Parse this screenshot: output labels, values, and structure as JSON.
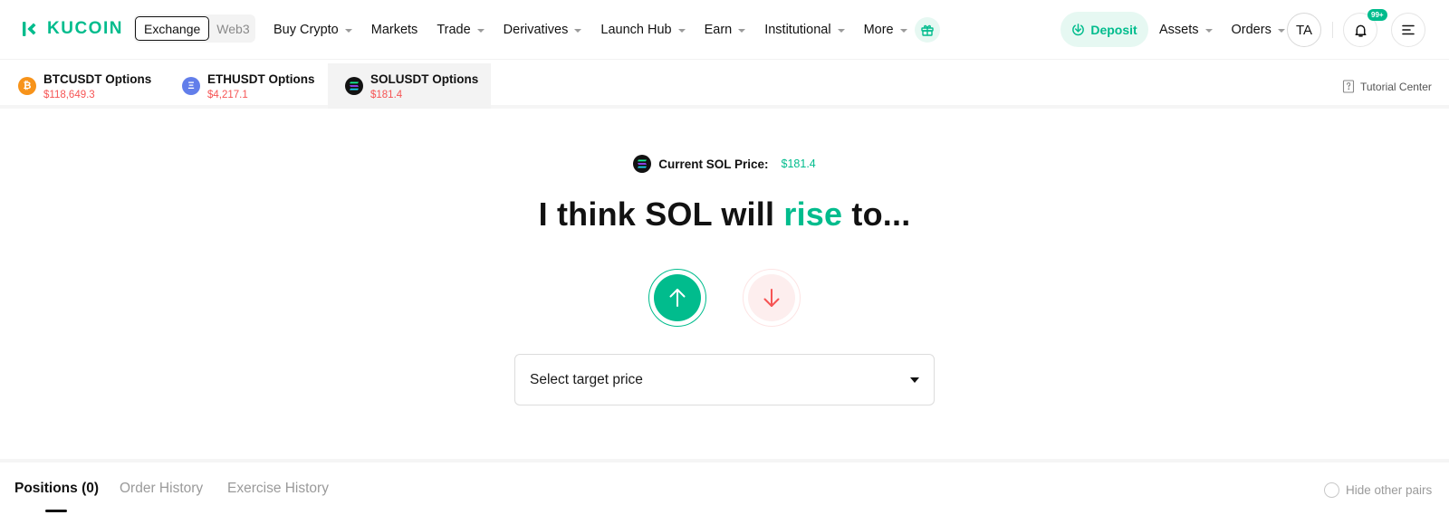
{
  "header": {
    "logo_text": "KUCOIN",
    "exchange_label": "Exchange",
    "web3_label": "Web3",
    "menu": [
      {
        "label": "Buy Crypto",
        "has_caret": true
      },
      {
        "label": "Markets",
        "has_caret": false
      },
      {
        "label": "Trade",
        "has_caret": true
      },
      {
        "label": "Derivatives",
        "has_caret": true
      },
      {
        "label": "Launch Hub",
        "has_caret": true
      },
      {
        "label": "Earn",
        "has_caret": true
      },
      {
        "label": "Institutional",
        "has_caret": true
      },
      {
        "label": "More",
        "has_caret": true
      }
    ],
    "deposit_label": "Deposit",
    "assets_label": "Assets",
    "orders_label": "Orders",
    "avatar_initials": "TA",
    "notification_badge": "99+",
    "icons": [
      "kucoin-logo-icon",
      "gift-icon",
      "download-icon",
      "bell-icon",
      "menu-icon"
    ],
    "accent_color": "#01bc8d"
  },
  "options_tabs": [
    {
      "name": "BTCUSDT Options",
      "price": "$118,649.3",
      "coin_color": "#f7931a",
      "coin_glyph": "₿",
      "active": false
    },
    {
      "name": "ETHUSDT Options",
      "price": "$4,217.1",
      "coin_color": "#627eea",
      "coin_glyph": "Ξ",
      "active": false
    },
    {
      "name": "SOLUSDT Options",
      "price": "$181.4",
      "coin_color": "#121212",
      "coin_glyph": "≡",
      "active": true
    }
  ],
  "tutorial_label": "Tutorial Center",
  "main": {
    "current_price_label": "Current SOL Price:",
    "current_price_value": "$181.4",
    "headline_pre": "I think SOL will ",
    "headline_highlight": "rise",
    "headline_post": " to...",
    "select_placeholder": "Select target price",
    "up_color": "#01bc8d",
    "down_color": "#f65454"
  },
  "bottom_tabs": [
    {
      "label": "Positions (0)",
      "active": true
    },
    {
      "label": "Order History",
      "active": false
    },
    {
      "label": "Exercise History",
      "active": false
    }
  ],
  "hide_pairs_label": "Hide other pairs"
}
